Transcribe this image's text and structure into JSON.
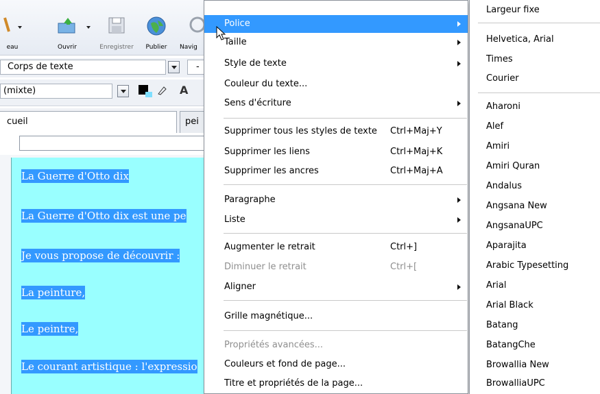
{
  "toolbar": {
    "items": [
      {
        "label": "eau",
        "icon": "table-icon"
      },
      {
        "label": "Ouvrir",
        "icon": "open-folder-icon"
      },
      {
        "label": "Enregistrer",
        "icon": "save-disk-icon"
      },
      {
        "label": "Publier",
        "icon": "globe-icon"
      },
      {
        "label": "Navig",
        "icon": "browse-icon"
      }
    ]
  },
  "format_bar": {
    "paragraph_style": "Corps de texte",
    "extra": "-"
  },
  "font_bar": {
    "font_select": "(mixte)",
    "letter": "A"
  },
  "tabs": {
    "tab1": "cueil",
    "tab2": "pei"
  },
  "editor_lines": [
    "La Guerre d'Otto dix",
    "La Guerre d'Otto dix est une pe",
    "Je vous propose de découvrir :",
    "La peinture,",
    "Le peintre,",
    "Le courant artistique : l'expressio"
  ],
  "menu": {
    "police": "Police",
    "taille": "Taille",
    "style_texte": "Style de texte",
    "couleur": "Couleur du texte...",
    "sens": "Sens d'écriture",
    "suppr_styles": "Supprimer tous les styles de texte",
    "suppr_styles_sc": "Ctrl+Maj+Y",
    "suppr_liens": "Supprimer les liens",
    "suppr_liens_sc": "Ctrl+Maj+K",
    "suppr_ancres": "Supprimer les ancres",
    "suppr_ancres_sc": "Ctrl+Maj+A",
    "paragraphe": "Paragraphe",
    "liste": "Liste",
    "augmenter": "Augmenter le retrait",
    "augmenter_sc": "Ctrl+]",
    "diminuer": "Diminuer le retrait",
    "diminuer_sc": "Ctrl+[",
    "aligner": "Aligner",
    "grille": "Grille magnétique...",
    "proprietes": "Propriétés avancées...",
    "couleurs_fond": "Couleurs et fond de page...",
    "titre": "Titre et propriétés de la page..."
  },
  "font_menu": {
    "largeur": "Largeur fixe",
    "helvetica": "Helvetica, Arial",
    "times": "Times",
    "courier": "Courier",
    "fonts": [
      "Aharoni",
      "Alef",
      "Amiri",
      "Amiri Quran",
      "Andalus",
      "Angsana New",
      "AngsanaUPC",
      "Aparajita",
      "Arabic Typesetting",
      "Arial",
      "Arial Black",
      "Batang",
      "BatangChe",
      "Browallia New",
      "BrowalliaUPC"
    ]
  },
  "colors": {
    "highlight": "#3399ff",
    "selection_bg": "#99ffff"
  }
}
